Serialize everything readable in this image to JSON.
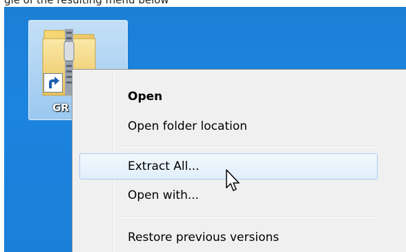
{
  "header_fragment": "gle of the resulting menu below",
  "desktop": {
    "background_color": "#1b84de",
    "icon": {
      "label": "GR",
      "icon_name": "zip-folder-icon",
      "overlay": "shortcut-arrow-icon",
      "selected": true
    }
  },
  "context_menu": {
    "items": [
      {
        "label": "Open",
        "default": true
      },
      {
        "label": "Open folder location"
      },
      {
        "label": "Extract All...",
        "hovered": true
      },
      {
        "label": "Open with..."
      },
      {
        "label": "Restore previous versions"
      }
    ]
  },
  "cursor": "arrow-pointer-icon"
}
